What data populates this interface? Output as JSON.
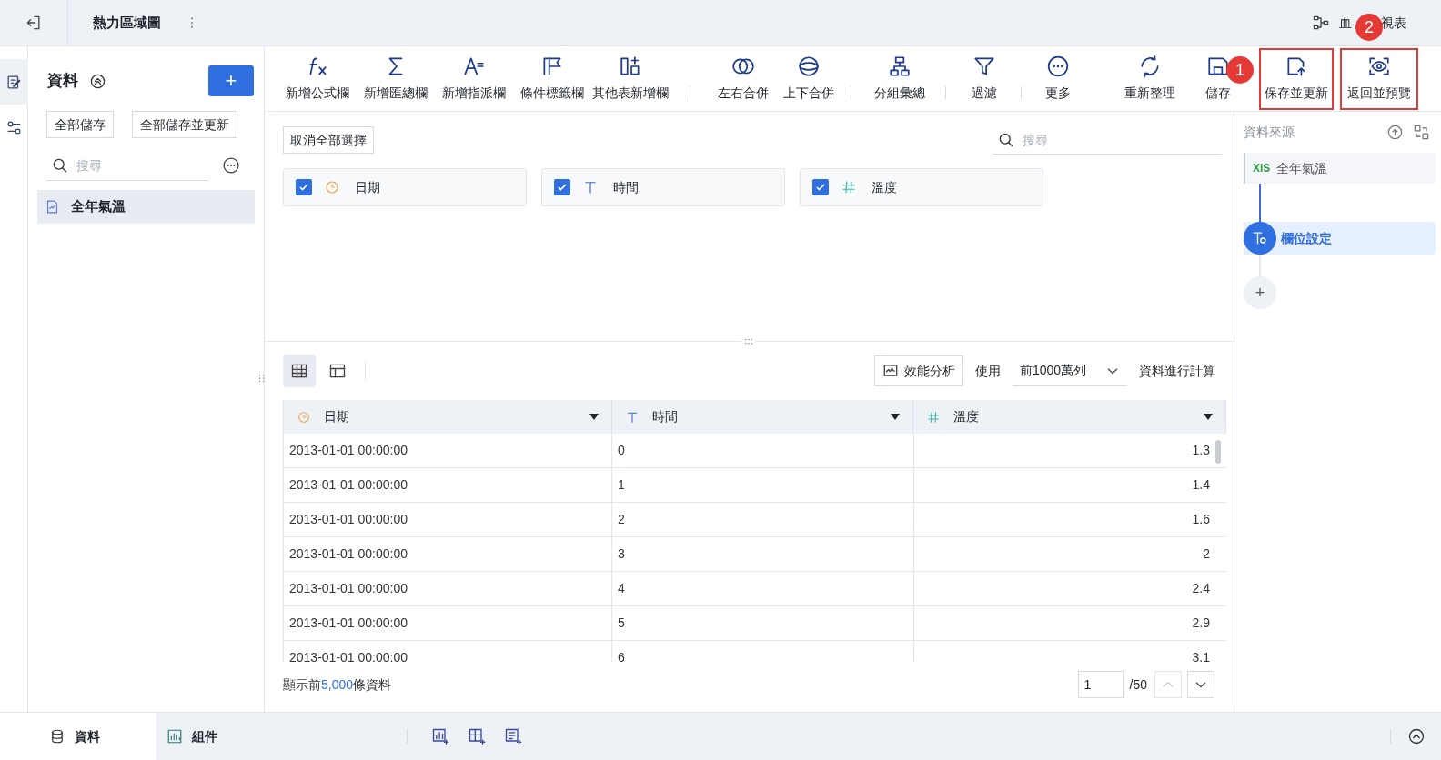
{
  "topbar": {
    "title": "熱力區域圖",
    "lineage_before": "血",
    "lineage_after": "視表"
  },
  "rail": [
    {
      "selected": true
    },
    {
      "selected": false
    }
  ],
  "left_panel": {
    "heading": "資料",
    "add_button": "+",
    "buttons": [
      "全部儲存",
      "全部儲存並更新"
    ],
    "search_placeholder": "搜尋",
    "items": [
      {
        "label": "全年氣溫",
        "selected": true
      }
    ]
  },
  "toolbar_groups": [
    {
      "items": [
        {
          "label": "新增公式欄",
          "highlighted": false
        },
        {
          "label": "新增匯總欄",
          "highlighted": false
        },
        {
          "label": "新增指派欄",
          "highlighted": false
        },
        {
          "label": "條件標籤欄",
          "highlighted": false
        },
        {
          "label": "其他表新增欄",
          "highlighted": false
        }
      ]
    },
    {
      "items": [
        {
          "label": "左右合併",
          "highlighted": false
        },
        {
          "label": "上下合併",
          "highlighted": false
        }
      ]
    },
    {
      "items": [
        {
          "label": "分組彙總",
          "highlighted": false
        }
      ]
    },
    {
      "items": [
        {
          "label": "過濾",
          "highlighted": false
        }
      ]
    },
    {
      "items": [
        {
          "label": "更多",
          "highlighted": false
        },
        {
          "label": "重新整理",
          "highlighted": false
        },
        {
          "label": "儲存",
          "highlighted": false
        },
        {
          "label": "保存並更新",
          "highlighted": true
        },
        {
          "label": "返回並預覽",
          "highlighted": true
        }
      ]
    }
  ],
  "badges": [
    {
      "label": "1"
    },
    {
      "label": "2"
    }
  ],
  "fields": {
    "deselect_button": "取消全部選擇",
    "search_placeholder": "搜尋",
    "items": [
      {
        "label": "日期",
        "kind": "date",
        "checked": true
      },
      {
        "label": "時間",
        "kind": "text",
        "checked": true
      },
      {
        "label": "溫度",
        "kind": "number",
        "checked": true
      }
    ]
  },
  "preview": {
    "views": [
      {
        "selected": true
      },
      {
        "selected": false
      }
    ],
    "perf_button": "效能分析",
    "use_label": "使用",
    "rows_select": "前1000萬列",
    "compute_label": "資料進行計算",
    "columns": [
      {
        "label": "日期",
        "kind": "date"
      },
      {
        "label": "時間",
        "kind": "text"
      },
      {
        "label": "溫度",
        "kind": "number"
      }
    ],
    "rows": [
      [
        "2013-01-01 00:00:00",
        "0",
        "1.3"
      ],
      [
        "2013-01-01 00:00:00",
        "1",
        "1.4"
      ],
      [
        "2013-01-01 00:00:00",
        "2",
        "1.6"
      ],
      [
        "2013-01-01 00:00:00",
        "3",
        "2"
      ],
      [
        "2013-01-01 00:00:00",
        "4",
        "2.4"
      ],
      [
        "2013-01-01 00:00:00",
        "5",
        "2.9"
      ],
      [
        "2013-01-01 00:00:00",
        "6",
        "3.1"
      ]
    ],
    "footer_before": "顯示前",
    "footer_count": "5,000",
    "footer_after": "條資料",
    "page": "1",
    "page_total": "/50"
  },
  "right_panel": {
    "heading": "資料來源",
    "source": {
      "badge": "XlS",
      "label": "全年氣溫"
    },
    "steps": [
      {
        "label": "欄位設定",
        "selected": true
      }
    ],
    "add": "+"
  },
  "bottom_tabs": [
    {
      "label": "資料",
      "selected": true
    },
    {
      "label": "組件",
      "selected": false
    }
  ]
}
